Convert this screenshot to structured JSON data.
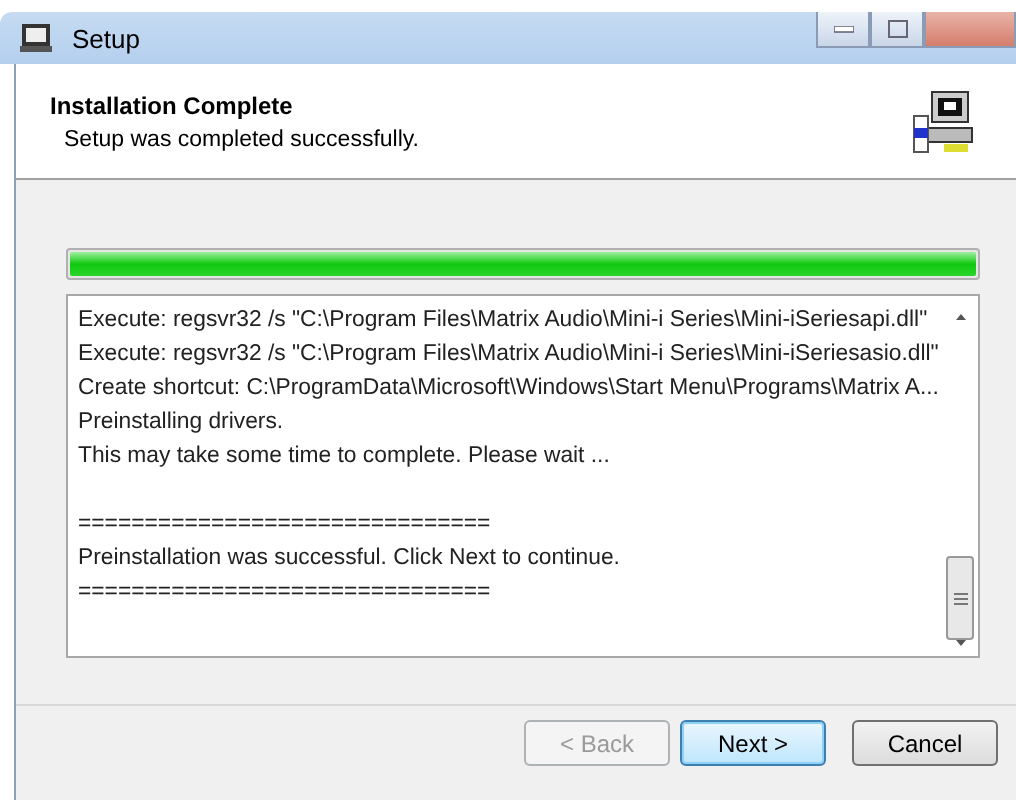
{
  "window": {
    "title": "Setup"
  },
  "header": {
    "title": "Installation Complete",
    "subtitle": "Setup was completed successfully."
  },
  "progress": {
    "level": 1
  },
  "log": [
    {
      "lines": [
        "Execute: regsvr32 /s \"C:\\Program Files\\Matrix Audio\\Mini-i Series\\Mini-iSeriesapi.dll\"",
        "Execute: regsvr32 /s \"C:\\Program Files\\Matrix Audio\\Mini-i Series\\Mini-iSeriesasio.dll\"",
        "Create shortcut: C:\\ProgramData\\Microsoft\\Windows\\Start Menu\\Programs\\Matrix A...",
        "Preinstalling drivers.",
        "This may take some time to complete. Please wait ..."
      ]
    },
    {
      "lines": [
        "===============================",
        "Preinstallation was successful. Click Next to continue.",
        "==============================="
      ]
    }
  ],
  "buttons": [
    {
      "label": "< Back",
      "disabled": true,
      "default": false
    },
    {
      "label": "Next >",
      "disabled": false,
      "default": true
    },
    {
      "label": "Cancel",
      "disabled": false,
      "default": false
    }
  ]
}
